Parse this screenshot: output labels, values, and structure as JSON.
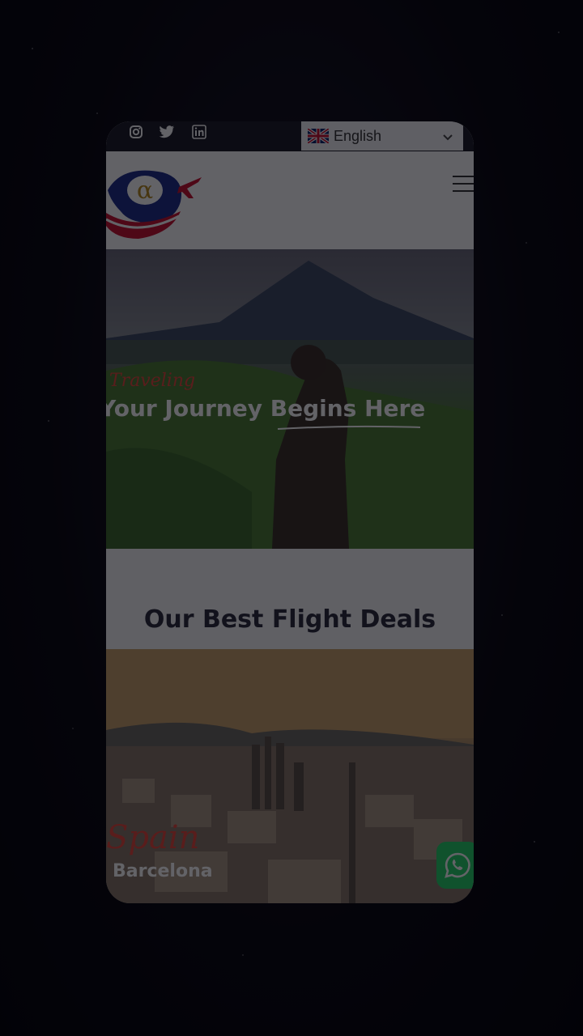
{
  "topbar": {
    "social": [
      "instagram-icon",
      "twitter-icon",
      "linkedin-icon"
    ],
    "language": {
      "label": "English",
      "flag": "uk-flag-icon"
    }
  },
  "header": {
    "logo_letter": "α"
  },
  "hero": {
    "script_label": "Traveling",
    "title": "Your Journey Begins Here"
  },
  "deals": {
    "title": "Our Best Flight Deals"
  },
  "destination": {
    "country": "Spain",
    "city": "Barcelona"
  },
  "colors": {
    "accent": "#e5483a",
    "whatsapp": "#25d366",
    "topbar": "#1c1b26"
  }
}
